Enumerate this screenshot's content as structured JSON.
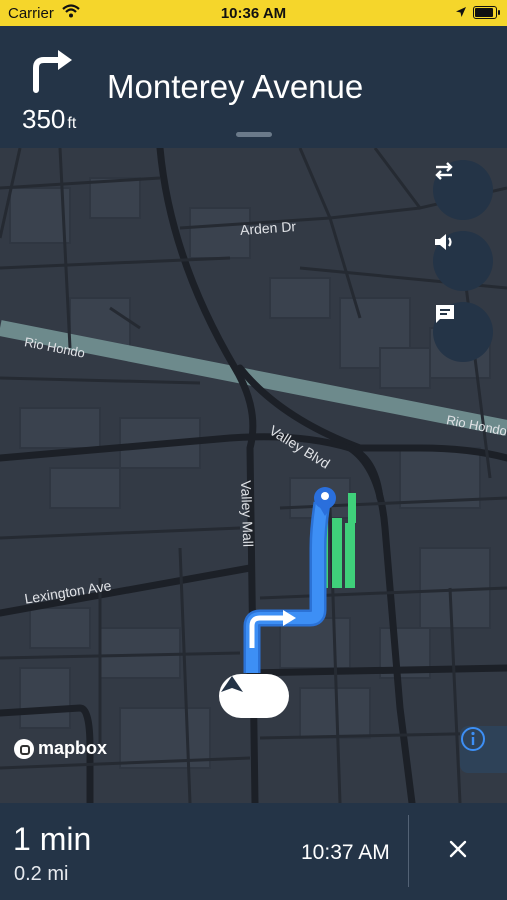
{
  "status_bar": {
    "carrier": "Carrier",
    "time": "10:36 AM"
  },
  "instruction": {
    "distance_value": "350",
    "distance_unit": "ft",
    "street": "Monterey Avenue",
    "maneuver_icon": "turn-right-icon"
  },
  "map": {
    "labels": {
      "arden": "Arden Dr",
      "rio1": "Rio Hondo",
      "rio2": "Rio Hondo",
      "valley_blvd": "Valley Blvd",
      "valley_mall": "Valley Mall",
      "lexington": "Lexington Ave"
    },
    "attribution": "mapbox",
    "buttons": [
      "route-overview-icon",
      "volume-icon",
      "feedback-icon",
      "info-icon"
    ],
    "colors": {
      "route": "#3d8ff5",
      "destination_area": "#3fd07a",
      "ui_dark": "#243447",
      "status_bar": "#f5d62b"
    }
  },
  "trip": {
    "remaining_time": "1 min",
    "remaining_distance": "0.2 mi",
    "arrival_time": "10:37 AM"
  }
}
